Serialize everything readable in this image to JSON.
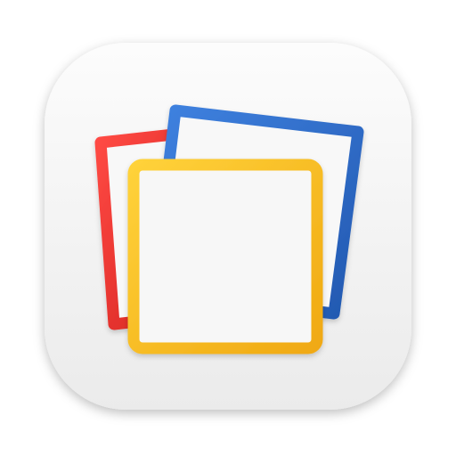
{
  "icon": {
    "name": "notes-app-icon",
    "colors": {
      "background_top": "#fbfbfb",
      "background_bottom": "#ececec",
      "red_card": "#e8322d",
      "blue_card": "#2f6fc9",
      "yellow_card": "#f5be1c",
      "text_lines": "#2f6fc9",
      "card_fill": "#f7f7f7"
    }
  }
}
